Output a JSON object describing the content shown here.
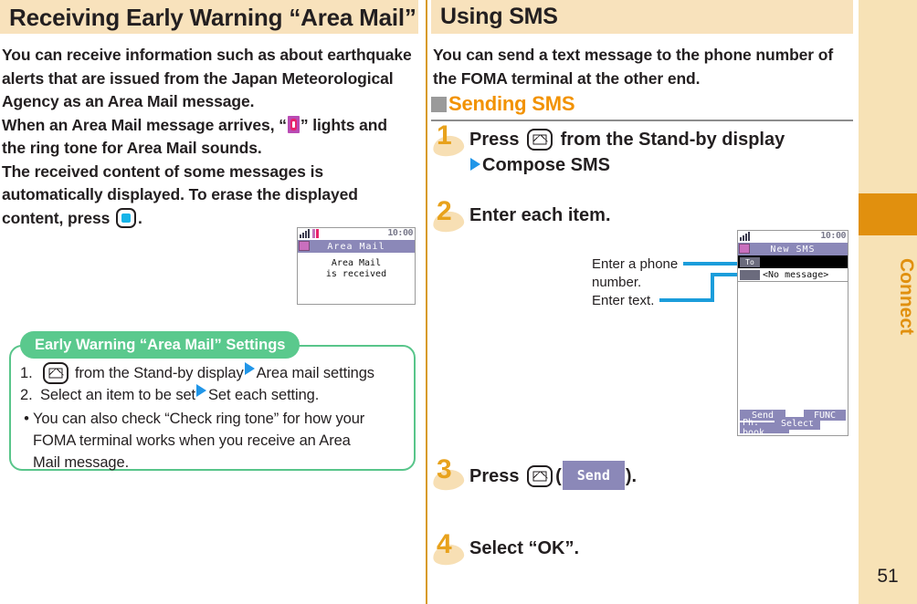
{
  "sidebar": {
    "tab_label": "Connect",
    "page_number": "51",
    "tab_color": "#e1900e",
    "strip_color": "#f7e2b6"
  },
  "left_column": {
    "header": "Receiving Early Warning “Area Mail”",
    "paragraph_lines": [
      "You can receive information such as about earthquake",
      "alerts that are issued from the Japan Meteorological",
      "Agency as an Area Mail message.",
      "When an Area Mail message arrives, “",
      "” lights and",
      "the ring tone for Area Mail sounds.",
      "The received content of some messages is",
      "automatically displayed. To erase the displayed",
      "content, press",
      "."
    ],
    "phone_screen": {
      "clock": "10:00",
      "title": "Area Mail",
      "body_line1": "Area Mail",
      "body_line2": "is received"
    },
    "tip_box": {
      "title": "Early Warning “Area Mail” Settings",
      "item1_number": "1.",
      "item1_before": "from the Stand-by display",
      "item1_after": "Area mail settings",
      "item2_number": "2.",
      "item2_before": "Select an item to be set",
      "item2_after": "Set each setting.",
      "bullet_char": "•",
      "bullet_lines": [
        "You can also check “Check ring tone” for how your",
        "FOMA terminal works when you receive an Area",
        "Mail message."
      ]
    }
  },
  "right_column": {
    "header": "Using SMS",
    "paragraph_lines": [
      "You can send a text message to the phone number of",
      "the FOMA terminal at the other end."
    ],
    "subhead": "Sending SMS",
    "steps": [
      {
        "number": "1",
        "line1_before": "Press",
        "line1_after": "from the Stand-by display",
        "line2": "Compose SMS"
      },
      {
        "number": "2",
        "line1": "Enter each item."
      },
      {
        "number": "3",
        "line1_before": "Press",
        "line1_mid": "(",
        "chip": "Send",
        "line1_after": ")."
      },
      {
        "number": "4",
        "line1": "Select “OK”."
      }
    ],
    "callouts": [
      {
        "line1": "Enter a phone",
        "line2": "number."
      },
      {
        "line1": "Enter text."
      }
    ],
    "phone_screen": {
      "clock": "10:00",
      "title": "New SMS",
      "to_tag": "To",
      "to_value": "",
      "msg_tag": "",
      "msg_value": "<No message>",
      "softkey_left_top": "Send",
      "softkey_left_bottom": "Ph. book",
      "softkey_center": "Select",
      "softkey_right": "FUNC"
    }
  },
  "colors": {
    "band": "#f8e2bc",
    "accent_orange": "#f29200",
    "green": "#5ac98d",
    "divider": "#d79a20",
    "blue": "#1b9ddb",
    "phone_purple": "#8b88b8"
  }
}
